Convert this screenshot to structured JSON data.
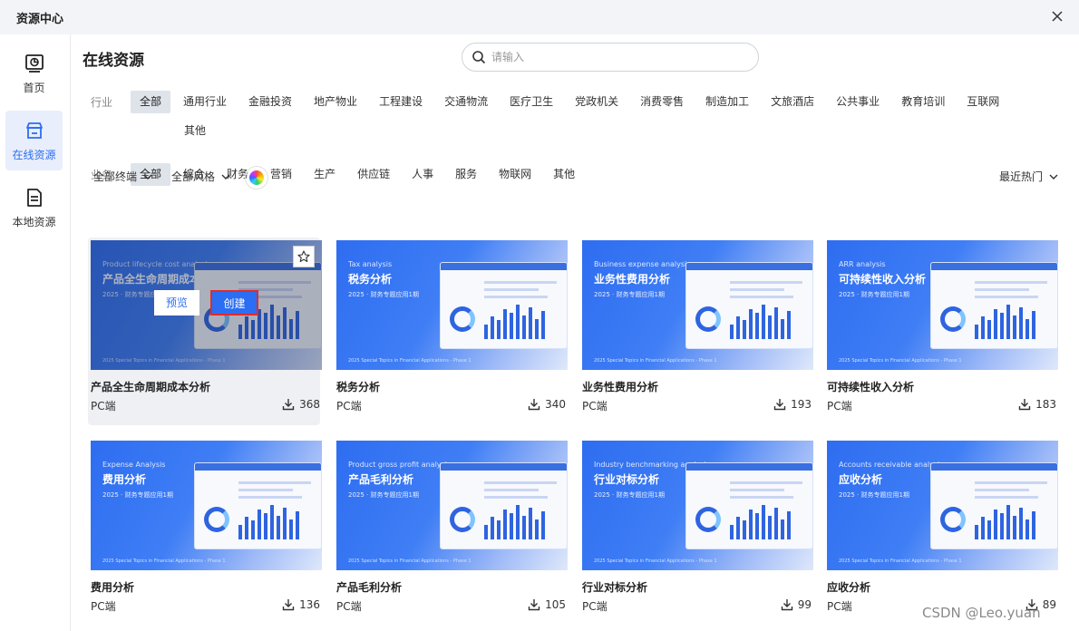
{
  "window": {
    "title": "资源中心"
  },
  "sidebar": {
    "items": [
      {
        "label": "首页",
        "icon": "home-chart-icon"
      },
      {
        "label": "在线资源",
        "icon": "online-store-icon",
        "active": true
      },
      {
        "label": "本地资源",
        "icon": "local-file-icon"
      }
    ]
  },
  "main": {
    "title": "在线资源",
    "search": {
      "placeholder": "请输入",
      "value": ""
    }
  },
  "filters": {
    "industry": {
      "label": "行业",
      "options": [
        "全部",
        "通用行业",
        "金融投资",
        "地产物业",
        "工程建设",
        "交通物流",
        "医疗卫生",
        "党政机关",
        "消费零售",
        "制造加工",
        "文旅酒店",
        "公共事业",
        "教育培训",
        "互联网",
        "其他"
      ],
      "selected": "全部"
    },
    "business": {
      "label": "业务",
      "options": [
        "全部",
        "综合",
        "财务",
        "营销",
        "生产",
        "供应链",
        "人事",
        "服务",
        "物联网",
        "其他"
      ],
      "selected": "全部"
    },
    "terminal": "全部终端",
    "style": "全部风格",
    "sort": "最近热门"
  },
  "cards": [
    {
      "name": "产品全生命周期成本分析",
      "platform": "PC端",
      "downloads": "368",
      "thumb_en": "Product lifecycle cost analysis",
      "thumb_zh": "产品全生命周期成本分析",
      "thumb_sub": "2025 · 财务专题应用1期"
    },
    {
      "name": "税务分析",
      "platform": "PC端",
      "downloads": "340",
      "thumb_en": "Tax analysis",
      "thumb_zh": "税务分析",
      "thumb_sub": "2025 · 财务专题应用1期"
    },
    {
      "name": "业务性费用分析",
      "platform": "PC端",
      "downloads": "193",
      "thumb_en": "Business expense analysis",
      "thumb_zh": "业务性费用分析",
      "thumb_sub": "2025 · 财务专题应用1期"
    },
    {
      "name": "可持续性收入分析",
      "platform": "PC端",
      "downloads": "183",
      "thumb_en": "ARR analysis",
      "thumb_zh": "可持续性收入分析",
      "thumb_sub": "2025 · 财务专题应用1期"
    },
    {
      "name": "费用分析",
      "platform": "PC端",
      "downloads": "136",
      "thumb_en": "Expense Analysis",
      "thumb_zh": "费用分析",
      "thumb_sub": "2025 · 财务专题应用1期"
    },
    {
      "name": "产品毛利分析",
      "platform": "PC端",
      "downloads": "105",
      "thumb_en": "Product gross profit analysis",
      "thumb_zh": "产品毛利分析",
      "thumb_sub": "2025 · 财务专题应用1期"
    },
    {
      "name": "行业对标分析",
      "platform": "PC端",
      "downloads": "99",
      "thumb_en": "Industry benchmarking analysis",
      "thumb_zh": "行业对标分析",
      "thumb_sub": "2025 · 财务专题应用1期"
    },
    {
      "name": "应收分析",
      "platform": "PC端",
      "downloads": "89",
      "thumb_en": "Accounts receivable analysis",
      "thumb_zh": "应收分析",
      "thumb_sub": "2025 · 财务专题应用1期"
    }
  ],
  "thumb_footer": "2025 Special Topics in Financial Applications - Phase 1",
  "hover_actions": {
    "preview": "预览",
    "create": "创建"
  },
  "watermark": "CSDN @Leo.yuan",
  "colors": {
    "accent": "#2b6ef3",
    "selected_chip": "#dfe3ea",
    "highlight_border": "#e02b2b"
  }
}
